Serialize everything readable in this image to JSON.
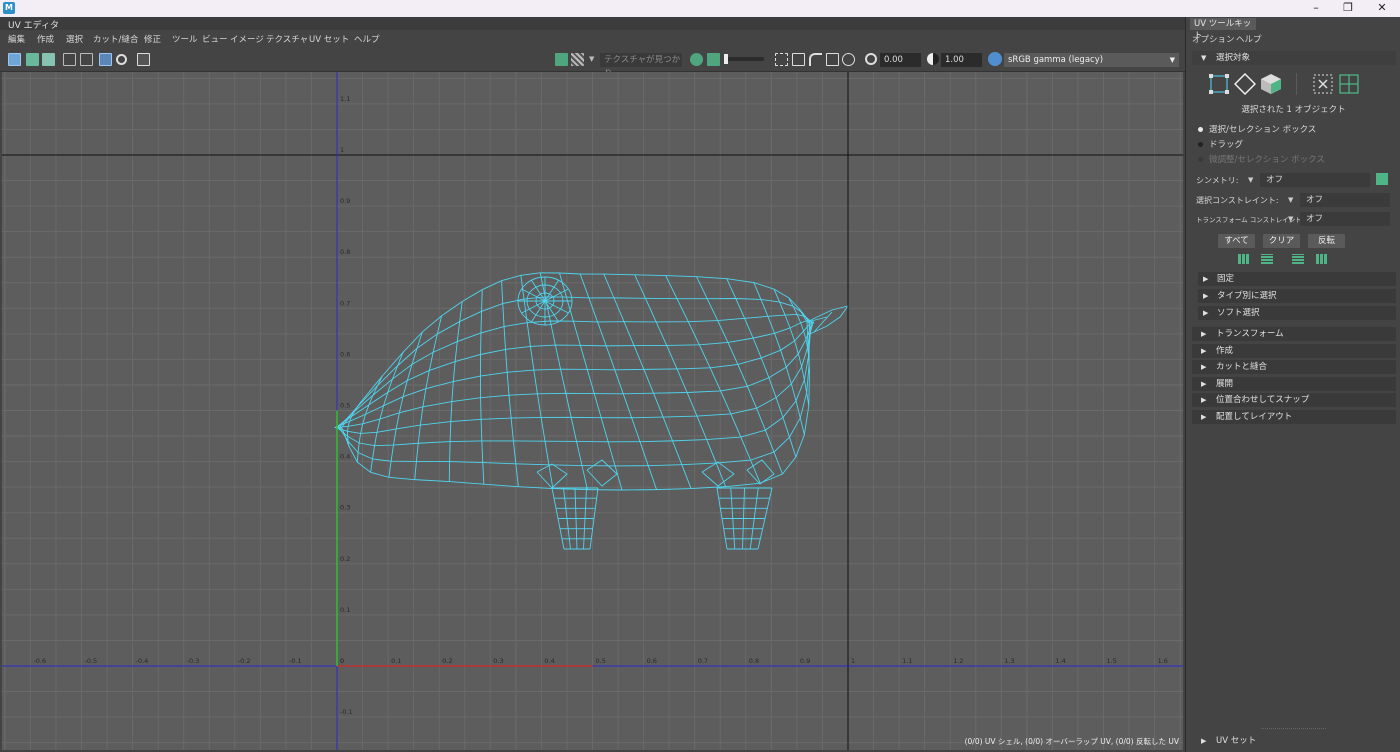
{
  "window": {
    "app_icon_text": "M",
    "controls": [
      "–",
      "❐",
      "✕"
    ]
  },
  "editor": {
    "title": "UV エディタ",
    "menu": [
      "編集",
      "作成",
      "選択",
      "カット/縫合",
      "修正",
      "ツール",
      "ビュー",
      "イメージ",
      "テクスチャ",
      "UV セット",
      "ヘルプ"
    ],
    "toolbar": {
      "texture_dropdown": "テクスチャが見つかり...",
      "exposure_value": "0.00",
      "gamma_value": "1.00",
      "colorspace": "sRGB gamma (legacy)"
    },
    "viewport": {
      "status": "(0/0) UV シェル, (0/0) オーバーラップ UV, (0/0) 反転した UV",
      "x_ticks": [
        "-0.6",
        "-0.5",
        "-0.4",
        "-0.3",
        "-0.2",
        "-0.1",
        "0",
        "0.1",
        "0.2",
        "0.3",
        "0.4",
        "0.5",
        "0.6",
        "0.7",
        "0.8",
        "0.9",
        "1",
        "1.1",
        "1.2",
        "1.3",
        "1.4",
        "1.5",
        "1.6"
      ],
      "y_ticks": [
        "1.1",
        "1",
        "0.9",
        "0.8",
        "0.7",
        "0.6",
        "0.5",
        "0.4",
        "0.3",
        "0.2",
        "0.1",
        "0",
        "-0.1"
      ],
      "colors": {
        "background": "#5d5d5d",
        "grid": "#6a6a6a",
        "uv_wire": "#4fd4ee",
        "u_axis": "#c03030",
        "v_axis": "#2ec02e",
        "boundary_blue": "#2a2ad0"
      }
    }
  },
  "toolkit": {
    "tab": "UV ツールキット",
    "menu": [
      "オプション",
      "ヘルプ"
    ],
    "selection": {
      "header": "選択対象",
      "info": "選択された 1 オブジェクト",
      "modes": [
        {
          "label": "選択/セレクション ボックス",
          "state": "selected"
        },
        {
          "label": "ドラッグ",
          "state": "normal"
        },
        {
          "label": "微調整/セレクション ボックス",
          "state": "disabled"
        }
      ],
      "symmetry_label": "シンメトリ:",
      "symmetry_value": "オフ",
      "constraint_label": "選択コンストレイント:",
      "constraint_value": "オフ",
      "transform_constraint_label": "トランスフォーム コンストレイント:",
      "transform_constraint_value": "オフ",
      "buttons": [
        "すべて",
        "クリア",
        "反転"
      ],
      "subsections": [
        "固定",
        "タイプ別に選択",
        "ソフト選択"
      ]
    },
    "sections": [
      "トランスフォーム",
      "作成",
      "カットと縫合",
      "展開",
      "位置合わせしてスナップ",
      "配置してレイアウト"
    ],
    "footer": "UV セット"
  }
}
